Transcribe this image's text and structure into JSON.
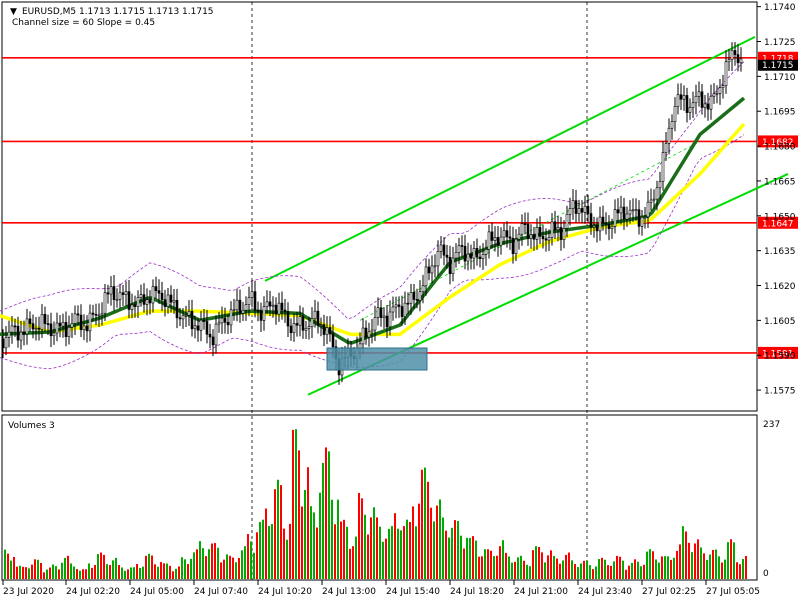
{
  "header": {
    "symbol_line": "EURUSD,M5  1.1713 1.1715 1.1713 1.1715",
    "indicator_line": "Channel size = 60 Slope = 0.45"
  },
  "volume_panel": {
    "title": "Volumes 3",
    "max_label": "237",
    "zero_label": "0"
  },
  "colors": {
    "level_line": "#ff0000",
    "channel": "#00dd00",
    "ma_fast": "#1a6e1a",
    "ma_slow": "#ffff00",
    "envelope": "#9b30c8",
    "candle": "#000000",
    "volume_up": "#00aa00",
    "volume_down": "#ff0000",
    "entry_box": "#4f8fa8"
  },
  "chart_data": {
    "type": "candlestick",
    "symbol": "EURUSD",
    "timeframe": "M5",
    "y_ticks": [
      "1.1740",
      "1.1725",
      "1.1710",
      "1.1695",
      "1.1680",
      "1.1665",
      "1.1650",
      "1.1635",
      "1.1620",
      "1.1605",
      "1.1590",
      "1.1575"
    ],
    "ylim": [
      1.1566,
      1.1742
    ],
    "x_ticks": [
      "23 Jul 2020",
      "24 Jul 02:20",
      "24 Jul 05:00",
      "24 Jul 07:40",
      "24 Jul 10:20",
      "24 Jul 13:00",
      "24 Jul 15:40",
      "24 Jul 18:20",
      "24 Jul 21:00",
      "24 Jul 23:40",
      "27 Jul 02:25",
      "27 Jul 05:05"
    ],
    "levels": [
      {
        "price": 1.1718,
        "label": "1.1718"
      },
      {
        "price": 1.1682,
        "label": "1.1682"
      },
      {
        "price": 1.1647,
        "label": "1.1647"
      },
      {
        "price": 1.1591,
        "label": "1.1591"
      }
    ],
    "current_price": {
      "price": 1.1715,
      "label": "1.1715"
    },
    "close_path": [
      [
        0,
        1.1597
      ],
      [
        12,
        1.16
      ],
      [
        25,
        1.1601
      ],
      [
        38,
        1.1604
      ],
      [
        50,
        1.1602
      ],
      [
        62,
        1.1601
      ],
      [
        75,
        1.1605
      ],
      [
        88,
        1.1603
      ],
      [
        100,
        1.161
      ],
      [
        112,
        1.1618
      ],
      [
        125,
        1.1614
      ],
      [
        138,
        1.1612
      ],
      [
        150,
        1.1616
      ],
      [
        162,
        1.1616
      ],
      [
        175,
        1.161
      ],
      [
        188,
        1.1605
      ],
      [
        200,
        1.1603
      ],
      [
        212,
        1.1598
      ],
      [
        225,
        1.1606
      ],
      [
        238,
        1.161
      ],
      [
        250,
        1.1614
      ],
      [
        262,
        1.1608
      ],
      [
        275,
        1.1613
      ],
      [
        288,
        1.1604
      ],
      [
        300,
        1.1602
      ],
      [
        312,
        1.1605
      ],
      [
        325,
        1.1603
      ],
      [
        338,
        1.1586
      ],
      [
        350,
        1.159
      ],
      [
        362,
        1.1596
      ],
      [
        375,
        1.1606
      ],
      [
        388,
        1.1607
      ],
      [
        400,
        1.1611
      ],
      [
        412,
        1.1613
      ],
      [
        425,
        1.1622
      ],
      [
        438,
        1.1635
      ],
      [
        450,
        1.163
      ],
      [
        462,
        1.1636
      ],
      [
        475,
        1.1631
      ],
      [
        488,
        1.1638
      ],
      [
        500,
        1.1642
      ],
      [
        512,
        1.1638
      ],
      [
        525,
        1.1645
      ],
      [
        538,
        1.164
      ],
      [
        550,
        1.1643
      ],
      [
        562,
        1.1644
      ],
      [
        575,
        1.1656
      ],
      [
        588,
        1.1649
      ],
      [
        600,
        1.1645
      ],
      [
        612,
        1.1648
      ],
      [
        625,
        1.1653
      ],
      [
        638,
        1.1649
      ],
      [
        650,
        1.1653
      ],
      [
        662,
        1.1671
      ],
      [
        675,
        1.17
      ],
      [
        688,
        1.1698
      ],
      [
        700,
        1.17
      ],
      [
        712,
        1.1698
      ],
      [
        725,
        1.1712
      ],
      [
        735,
        1.1722
      ],
      [
        742,
        1.1715
      ]
    ],
    "ma_slow": [
      [
        0,
        1.1607
      ],
      [
        50,
        1.16
      ],
      [
        100,
        1.1603
      ],
      [
        150,
        1.1609
      ],
      [
        200,
        1.1609
      ],
      [
        250,
        1.1608
      ],
      [
        300,
        1.1607
      ],
      [
        350,
        1.1599
      ],
      [
        400,
        1.1599
      ],
      [
        450,
        1.1615
      ],
      [
        500,
        1.1629
      ],
      [
        550,
        1.1639
      ],
      [
        600,
        1.1645
      ],
      [
        650,
        1.1648
      ],
      [
        700,
        1.1668
      ],
      [
        745,
        1.169
      ]
    ],
    "ma_fast": [
      [
        0,
        1.1599
      ],
      [
        50,
        1.16
      ],
      [
        100,
        1.1606
      ],
      [
        150,
        1.1615
      ],
      [
        200,
        1.1605
      ],
      [
        250,
        1.1609
      ],
      [
        300,
        1.1608
      ],
      [
        350,
        1.1595
      ],
      [
        400,
        1.1603
      ],
      [
        450,
        1.163
      ],
      [
        500,
        1.1638
      ],
      [
        550,
        1.1643
      ],
      [
        600,
        1.1646
      ],
      [
        650,
        1.165
      ],
      [
        700,
        1.1685
      ],
      [
        745,
        1.1701
      ]
    ],
    "channel_upper": [
      [
        265,
        1.1622
      ],
      [
        755,
        1.1727
      ]
    ],
    "channel_lower": [
      [
        308,
        1.1573
      ],
      [
        788,
        1.1668
      ]
    ],
    "volume_max": 237,
    "volumes": [
      45,
      20,
      25,
      30,
      18,
      22,
      35,
      25,
      15,
      28,
      40,
      32,
      22,
      18,
      26,
      38,
      30,
      24,
      20,
      33,
      45,
      60,
      55,
      40,
      35,
      50,
      70,
      90,
      120,
      150,
      100,
      230,
      180,
      110,
      200,
      150,
      90,
      70,
      130,
      110,
      95,
      80,
      110,
      90,
      140,
      170,
      120,
      100,
      90,
      80,
      65,
      50,
      45,
      60,
      40,
      35,
      30,
      50,
      45,
      35,
      40,
      30,
      28,
      25,
      32,
      30,
      35,
      25,
      30,
      45,
      40,
      35,
      55,
      80,
      60,
      50,
      45,
      40,
      60,
      35
    ]
  }
}
